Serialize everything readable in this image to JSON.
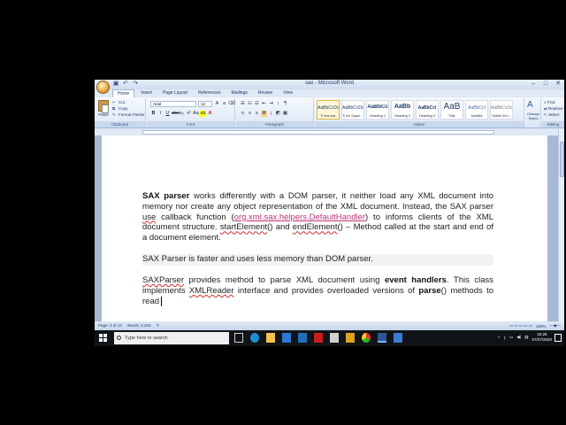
{
  "window": {
    "title": "sax - Microsoft Word",
    "controls": {
      "minimize": "–",
      "maximize": "□",
      "close": "✕"
    }
  },
  "qat": {
    "save": "💾",
    "undo": "↶",
    "redo": "↷"
  },
  "tabs": [
    {
      "label": "Home",
      "active": true
    },
    {
      "label": "Insert"
    },
    {
      "label": "Page Layout"
    },
    {
      "label": "References"
    },
    {
      "label": "Mailings"
    },
    {
      "label": "Review"
    },
    {
      "label": "View"
    }
  ],
  "ribbon": {
    "clipboard": {
      "paste": "Paste",
      "cut": "Cut",
      "copy": "Copy",
      "format_painter": "Format Painter",
      "group": "Clipboard"
    },
    "font": {
      "family": "Arial",
      "size": "12",
      "group": "Font"
    },
    "paragraph": {
      "group": "Paragraph"
    },
    "styles": {
      "group": "Styles",
      "tiles": [
        {
          "sample": "AaBbCcDc",
          "name": "¶ Normal",
          "active": true
        },
        {
          "sample": "AaBbCcDc",
          "name": "¶ No Spaci..."
        },
        {
          "sample": "AaBbCc",
          "name": "Heading 1"
        },
        {
          "sample": "AaBb",
          "name": "Heading 2"
        },
        {
          "sample": "AaBbCcI",
          "name": "Heading 3"
        },
        {
          "sample": "AaB",
          "name": "Title"
        },
        {
          "sample": "AaBbCcI",
          "name": "Subtitle"
        },
        {
          "sample": "AaBbCcDc",
          "name": "Subtle Em..."
        }
      ],
      "change_styles": "Change Styles"
    },
    "editing": {
      "find": "Find",
      "replace": "Replace",
      "select": "Select",
      "group": "Editing"
    }
  },
  "document": {
    "p1": {
      "b_sax_parser": "SAX parser",
      "t1": " works differently with a DOM parser, it neither load any XML document into memory nor create any object representation of the XML document. Instead, the SAX parser ",
      "use": "use",
      "t2": " callback function (",
      "link": "org.xml.sax.helpers.DefaultHandler",
      "t3": ") to informs clients of the XML document structure. ",
      "start_element": "startElement",
      "t4": "() and ",
      "end_element": "endElement",
      "t5": "() – Method called at the start and end of a document element."
    },
    "p2": "SAX Parser is faster and uses less memory than DOM parser.",
    "p3": {
      "saxparser": "SAXParser",
      "t1": " provides method to parse XML document using ",
      "b_event": "event handlers",
      "t2": ". This class implements ",
      "xmlreader": "XMLReader",
      "t3": " interface and provides overloaded versions of ",
      "b_parse": "parse",
      "t4": "() methods to read"
    }
  },
  "status": {
    "page": "Page: 3 of 13",
    "words": "Words: 2,343",
    "zoom": "100%"
  },
  "taskbar": {
    "search_placeholder": "Type here to search",
    "time": "15:25",
    "date": "07/07/2020"
  }
}
